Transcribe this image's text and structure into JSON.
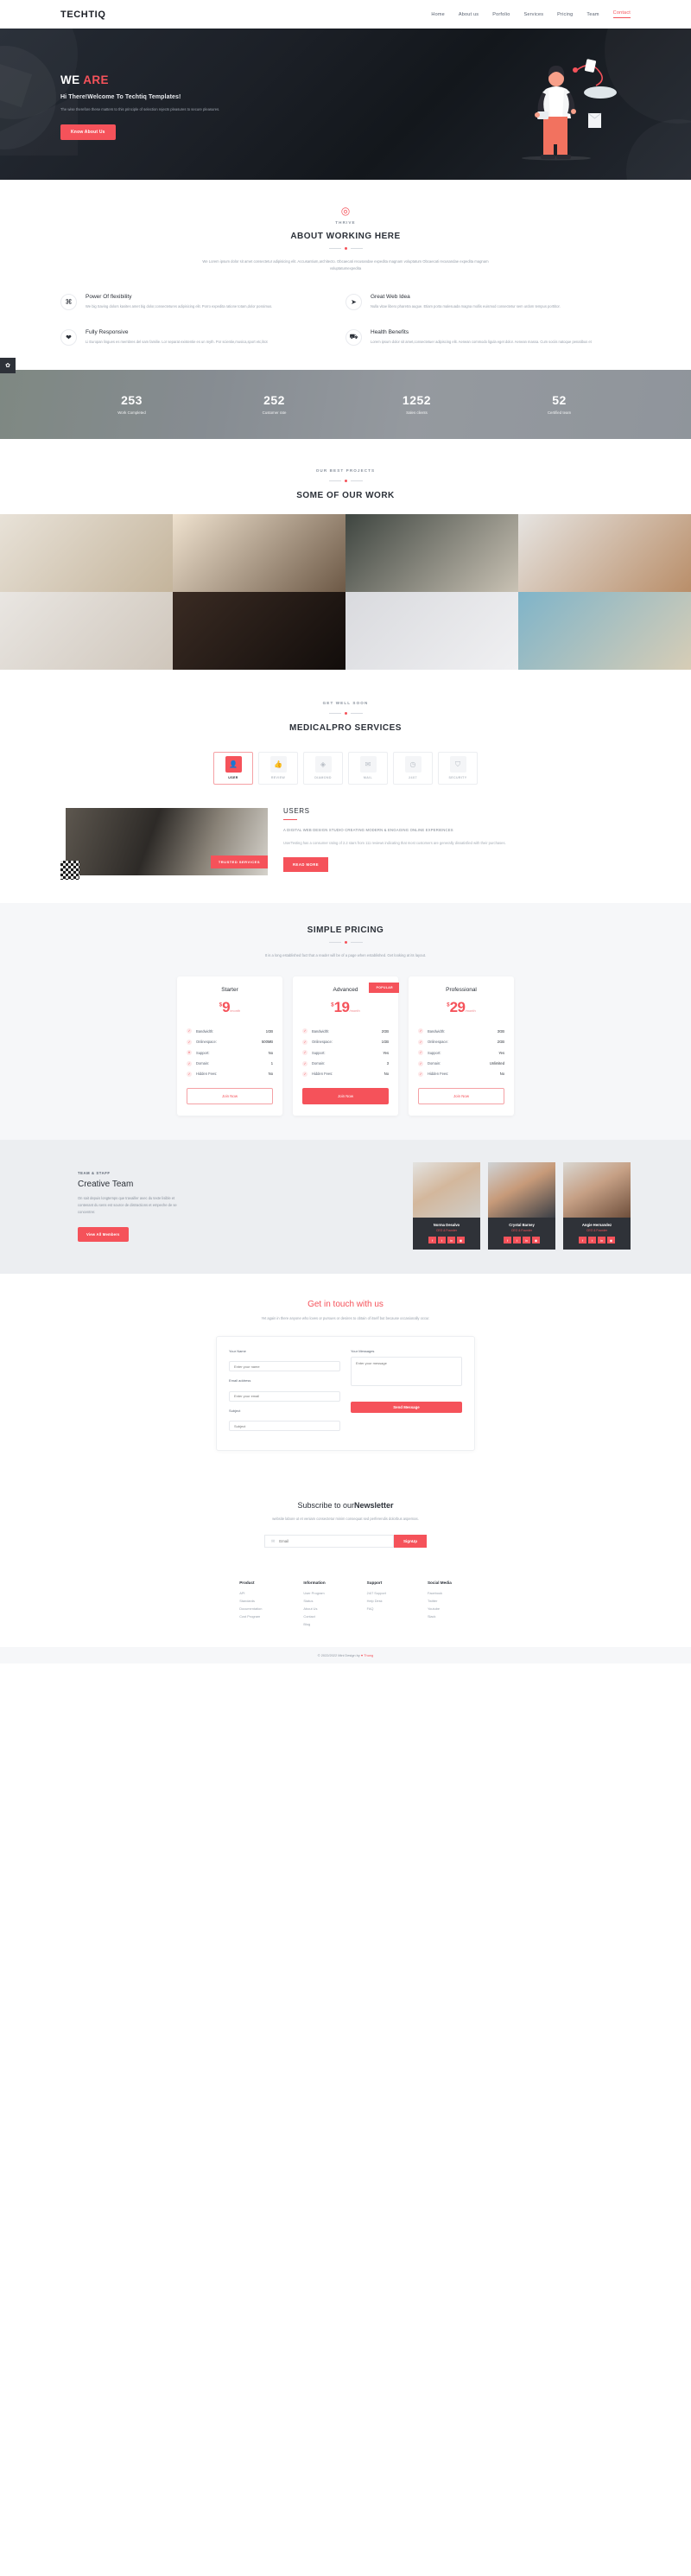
{
  "nav": {
    "logo": "TECHTIQ",
    "links": [
      {
        "label": "Home",
        "active": false
      },
      {
        "label": "About us",
        "active": false
      },
      {
        "label": "Porfolio",
        "active": false
      },
      {
        "label": "Services",
        "active": false
      },
      {
        "label": "Pricing",
        "active": false
      },
      {
        "label": "Team",
        "active": false
      },
      {
        "label": "Contact",
        "active": true
      }
    ]
  },
  "hero": {
    "kicker_white": "WE ",
    "kicker_red": "ARE",
    "subtitle": "Hi There!Welcome To Techtiq Templates!",
    "description": "The wise therefore these matters to this principle of selection rejects pleasures to secure pleasures.",
    "cta": "Know About Us"
  },
  "about": {
    "icon": "target-icon",
    "kicker": "THRIVE",
    "title": "ABOUT WORKING HERE",
    "description": "We Lorem ipsum dolor sit amet consectetur adipisicing elit. Accusantium,architecto. Obcaecati recusandae expedita magnam voluptatum Obcaecati recusandae expedita magnam voluptatumexpedita",
    "features": [
      {
        "icon": "command-icon",
        "title": "Power Of flexibility",
        "text": "We big Saving dolors kasites amet big dolor,consectetures adipisicing elit. Porro expedita ratione totam,dolor possimus."
      },
      {
        "icon": "twitter-bird-icon",
        "title": "Great Web Idea",
        "text": "Nulla vitae libero pharetra augue. Etiam porta malesuada magna mollis euismod consectetur sem urdom tempus porttitor."
      },
      {
        "icon": "heartbeat-icon",
        "title": "Fully Responsive",
        "text": "Li Europan lingues es membres del sam familie. Lor separat existentie es un myth. Por scientie,musica,sport etc,litot"
      },
      {
        "icon": "ambulance-icon",
        "title": "Health Benefits",
        "text": "Lorem ipsum dolor sit amet,consectetuer adipiscing elit. Aenean commodo ligula eget dolor. Aenean massa. Cum sociis natoque penatibus et"
      }
    ]
  },
  "stats": {
    "badge_icon": "gear-icon",
    "items": [
      {
        "number": "253",
        "label": "Work Completed"
      },
      {
        "number": "252",
        "label": "Customer rate"
      },
      {
        "number": "1252",
        "label": "Sales clients"
      },
      {
        "number": "52",
        "label": "Certified team"
      }
    ]
  },
  "portfolio": {
    "kicker": "OUR BEST PROJECTS",
    "title": "SOME OF OUR WORK",
    "tiles": [
      {
        "name": "sideboard-shelf",
        "c1": "#e8e2d8",
        "c2": "#c4b49b"
      },
      {
        "name": "wall-lamp",
        "c1": "#efe2cf",
        "c2": "#6d5946"
      },
      {
        "name": "woman-working",
        "c1": "#3e4540",
        "c2": "#c9c2b4"
      },
      {
        "name": "living-room-sofa",
        "c1": "#e6e4e1",
        "c2": "#b98e69"
      },
      {
        "name": "dining-table",
        "c1": "#e9e6e2",
        "c2": "#cfc6bb"
      },
      {
        "name": "man-jacket",
        "c1": "#3a2b23",
        "c2": "#120d0b"
      },
      {
        "name": "laptop-desk",
        "c1": "#d9dade",
        "c2": "#f0f0f2"
      },
      {
        "name": "beach-palms",
        "c1": "#7fb4c9",
        "c2": "#d7cdb6"
      }
    ]
  },
  "services": {
    "kicker": "GET WELL SOON",
    "title": "MEDICALPRO SERVICES",
    "tabs": [
      {
        "label": "USER",
        "icon": "user-icon",
        "active": true
      },
      {
        "label": "REVIEW",
        "icon": "thumbs-up-icon",
        "active": false
      },
      {
        "label": "DIAMOND",
        "icon": "diamond-icon",
        "active": false
      },
      {
        "label": "MAIL",
        "icon": "mail-icon",
        "active": false
      },
      {
        "label": "24X7",
        "icon": "clock-24-icon",
        "active": false
      },
      {
        "label": "SECURITY",
        "icon": "shield-icon",
        "active": false
      }
    ],
    "panel": {
      "badge": "TRUSTED SERVICES",
      "title": "USERS",
      "caption": "A DIGITAL WEB DESIGN STUDIO CREATING MODERN & ENGAGING ONLINE EXPERIENCES",
      "body": "UserTesting has a consumer rating of 2.2 stars from 111 reviews indicating that most customers are generally dissatisfied with their purchases.",
      "cta": "READ MORE"
    }
  },
  "pricing": {
    "title": "SIMPLE PRICING",
    "subtitle": "It is a long established fact that a reader will be of a page when established. Get looking at its layout.",
    "plans": [
      {
        "name": "Starter",
        "currency": "$",
        "amount": "9",
        "period": "/month",
        "featured": false,
        "ribbon": "",
        "rows": [
          {
            "label": "Bandwidth:",
            "value": "1GB",
            "ok": true
          },
          {
            "label": "Onlinespace:",
            "value": "500MB",
            "ok": true
          },
          {
            "label": "Support:",
            "value": "No",
            "ok": false
          },
          {
            "label": "Domain:",
            "value": "1",
            "ok": true
          },
          {
            "label": "Hidden Fees:",
            "value": "No",
            "ok": true
          }
        ],
        "cta": "Join Now"
      },
      {
        "name": "Advanced",
        "currency": "$",
        "amount": "19",
        "period": "/month",
        "featured": true,
        "ribbon": "POPULAR",
        "rows": [
          {
            "label": "Bandwidth:",
            "value": "2GB",
            "ok": true
          },
          {
            "label": "Onlinespace:",
            "value": "1GB",
            "ok": true
          },
          {
            "label": "Support:",
            "value": "Yes",
            "ok": true
          },
          {
            "label": "Domain:",
            "value": "3",
            "ok": true
          },
          {
            "label": "Hidden Fees:",
            "value": "No",
            "ok": true
          }
        ],
        "cta": "Join Now"
      },
      {
        "name": "Professional",
        "currency": "$",
        "amount": "29",
        "period": "/month",
        "featured": false,
        "ribbon": "",
        "rows": [
          {
            "label": "Bandwidth:",
            "value": "3GB",
            "ok": true
          },
          {
            "label": "Onlinespace:",
            "value": "2GB",
            "ok": true
          },
          {
            "label": "Support:",
            "value": "Yes",
            "ok": true
          },
          {
            "label": "Domain:",
            "value": "Unlimited",
            "ok": true
          },
          {
            "label": "Hidden Fees:",
            "value": "No",
            "ok": true
          }
        ],
        "cta": "Join Now"
      }
    ]
  },
  "team": {
    "kicker": "TEAM & STAFF",
    "title": "Creative Team",
    "text": "On sait depuis longtemps que travailler avec du texte lisible et contenant du sens est source de distractions et empeche de se concentrer.",
    "cta": "View All Members",
    "members": [
      {
        "name": "Norma Desalvo",
        "role": "CEO & Founder",
        "photo": "woman-blonde"
      },
      {
        "name": "Crystal Barney",
        "role": "CEO & Founder",
        "photo": "man-smiling"
      },
      {
        "name": "Angie Hernandez",
        "role": "CEO & Founder",
        "photo": "woman-brunette"
      }
    ],
    "social_icons": [
      "facebook-icon",
      "twitter-icon",
      "linkedin-icon",
      "instagram-icon"
    ]
  },
  "contact": {
    "title_dark": "Get in touch ",
    "title_red": "with us",
    "subtitle": "Yet again in there anyone who loves or pursues or desires to obtain of itself but because occasionally occur.",
    "fields": {
      "name_label": "Your Name",
      "name_placeholder": "Enter your name",
      "email_label": "Email address",
      "email_placeholder": "Enter your email",
      "subject_label": "Subject",
      "subject_placeholder": "Subject",
      "message_label": "Your Messages",
      "message_placeholder": "Enter your message",
      "submit": "Send Message"
    }
  },
  "newsletter": {
    "title_light": "Subscribe to our",
    "title_bold": "Newsletter",
    "subtitle": "website labore ut et veniam consectetur minim consequat sed perferendis dolorbus aspernas.",
    "icon": "envelope-icon",
    "placeholder": "Email",
    "button": "SignUp"
  },
  "footer": {
    "columns": [
      {
        "heading": "Product",
        "links": [
          "API",
          "Standards",
          "Documentation",
          "Cost Program"
        ]
      },
      {
        "heading": "Information",
        "links": [
          "User Program",
          "Status",
          "About Us",
          "Contact",
          "Blog"
        ]
      },
      {
        "heading": "Support",
        "links": [
          "24/7 Support",
          "Help Desk",
          "FAQ"
        ]
      },
      {
        "heading": "Social Media",
        "links": [
          "Facebook",
          "Twitter",
          "Youtube",
          "Slack"
        ]
      }
    ],
    "copyright_pre": "© 2022/2022 Mini Design by ",
    "copyright_link": "Thung",
    "heart": "♥"
  },
  "colors": {
    "accent": "#f5525a",
    "dark": "#2b3038",
    "muted": "#9aa2ad",
    "panel": "#f6f7f9"
  }
}
